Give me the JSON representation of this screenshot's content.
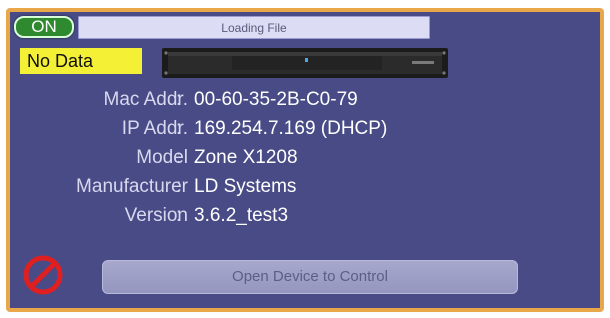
{
  "status": {
    "on_label": "ON",
    "no_data_label": "No Data"
  },
  "loading": {
    "label": "Loading File",
    "progress": 0.0
  },
  "device_info": [
    {
      "label": "Mac Addr.",
      "value": "00-60-35-2B-C0-79"
    },
    {
      "label": "IP Addr.",
      "value": "169.254.7.169 (DHCP)"
    },
    {
      "label": "Model",
      "value": "Zone X1208"
    },
    {
      "label": "Manufacturer",
      "value": "LD Systems"
    },
    {
      "label": "Version",
      "value": "3.6.2_test3"
    }
  ],
  "actions": {
    "open_device_label": "Open Device to Control"
  },
  "icons": {
    "blocked": "no-entry-icon"
  },
  "colors": {
    "panel_bg": "#484b86",
    "panel_border": "#e8a84a",
    "on_badge": "#2f8a2f",
    "no_data_badge": "#f3f036",
    "blocked_icon": "#e02020"
  }
}
